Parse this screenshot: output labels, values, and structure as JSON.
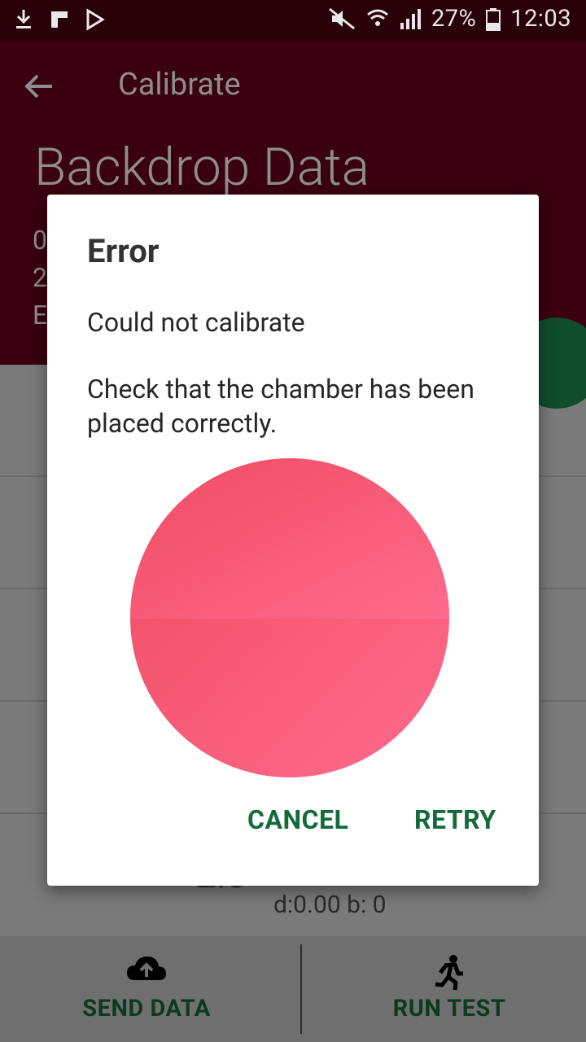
{
  "status_bar": {
    "battery": "27%",
    "time": "12:03"
  },
  "app_bar": {
    "title": "Calibrate",
    "heading": "Backdrop Data",
    "partial_lines": [
      "0",
      "2",
      "E"
    ]
  },
  "background": {
    "partial_value": "2.3",
    "row_details": "d:0.00  b: 0"
  },
  "dialog": {
    "title": "Error",
    "message": "Could not calibrate",
    "detail": "Check that the chamber has been placed correctly.",
    "cancel_label": "CANCEL",
    "retry_label": "RETRY",
    "swatch_color": "#ff5a7a"
  },
  "bottom_bar": {
    "send_label": "SEND DATA",
    "run_label": "RUN TEST"
  },
  "colors": {
    "app_bar": "#3a0010",
    "accent_green": "#146b3a"
  }
}
